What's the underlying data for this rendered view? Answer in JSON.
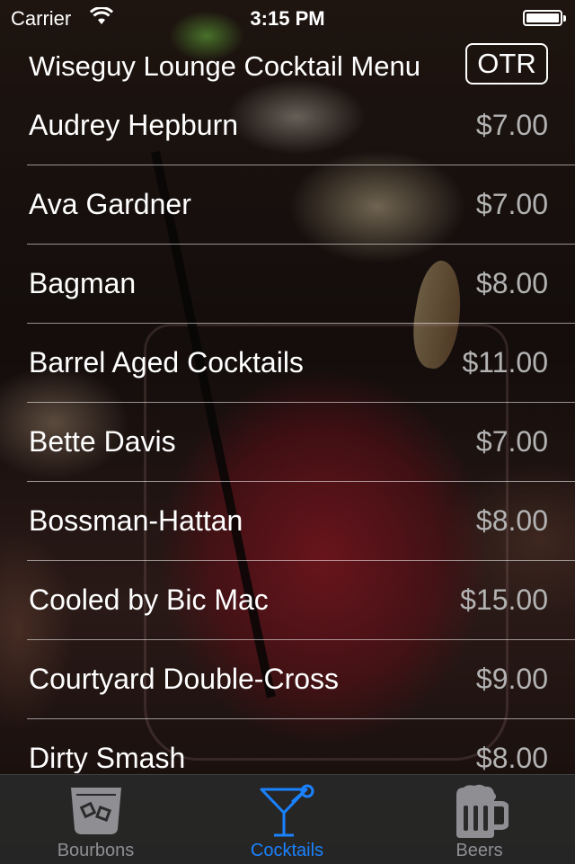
{
  "status_bar": {
    "carrier": "Carrier",
    "time": "3:15 PM"
  },
  "nav": {
    "title": "Wiseguy Lounge Cocktail Menu",
    "otr_button": "OTR"
  },
  "cocktails": [
    {
      "name": "Audrey Hepburn",
      "price": "$7.00"
    },
    {
      "name": "Ava Gardner",
      "price": "$7.00"
    },
    {
      "name": "Bagman",
      "price": "$8.00"
    },
    {
      "name": "Barrel Aged Cocktails",
      "price": "$11.00"
    },
    {
      "name": "Bette Davis",
      "price": "$7.00"
    },
    {
      "name": "Bossman-Hattan",
      "price": "$8.00"
    },
    {
      "name": "Cooled by Bic Mac",
      "price": "$15.00"
    },
    {
      "name": "Courtyard Double-Cross",
      "price": "$9.00"
    },
    {
      "name": "Dirty Smash",
      "price": "$8.00"
    }
  ],
  "tabs": [
    {
      "label": "Bourbons",
      "icon": "bourbon-glass-icon",
      "active": false
    },
    {
      "label": "Cocktails",
      "icon": "martini-glass-icon",
      "active": true
    },
    {
      "label": "Beers",
      "icon": "beer-mug-icon",
      "active": false
    }
  ],
  "colors": {
    "tab_active": "#1a82ff",
    "tab_inactive": "#8e8e93",
    "price": "#b3b3b3"
  }
}
